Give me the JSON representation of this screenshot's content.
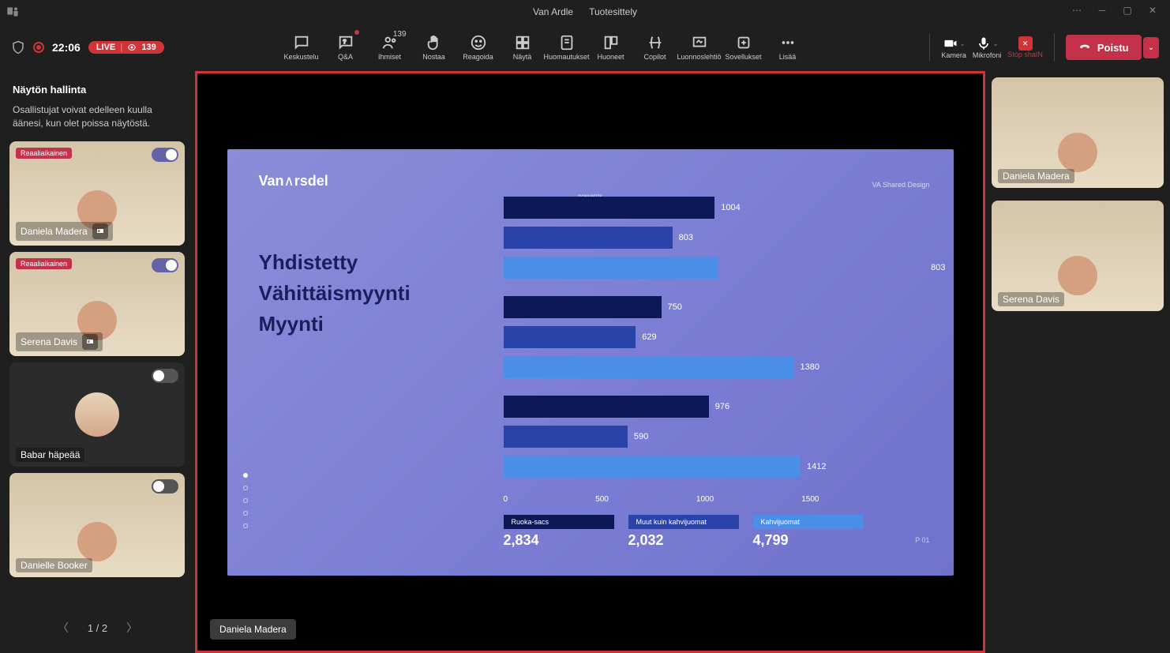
{
  "titlebar": {
    "org": "Van Ardle",
    "meeting": "Tuotesittely"
  },
  "toolbar": {
    "timer": "22:06",
    "live_label": "LIVE",
    "live_count": "139",
    "buttons": {
      "chat": "Keskustelu",
      "qa": "Q&A",
      "people": "Ihmiset",
      "people_count": "139",
      "raise": "Nostaa",
      "react": "Reagoida",
      "view": "Näytä",
      "notes": "Huomautukset",
      "rooms": "Huoneet",
      "copilot": "Copilot",
      "draft": "Luonnoslehtiö",
      "apps": "Sovellukset",
      "more": "Lisää"
    },
    "camera": "Kamera",
    "mic": "Mikrofoni",
    "stop_share": "Stop shaIN",
    "leave": "Poistu"
  },
  "sidebar": {
    "title": "Näytön hallinta",
    "desc": "Osallistujat voivat edelleen kuulla äänesi, kun olet poissa näytöstä.",
    "pager": "1 / 2",
    "participants": [
      {
        "name": "Daniela Madera",
        "live": true,
        "toggle_on": true,
        "pin": true
      },
      {
        "name": "Serena Davis",
        "live": true,
        "toggle_on": true,
        "pin": true
      },
      {
        "name": "Babar häpeää",
        "live": false,
        "toggle_on": false,
        "pin": false,
        "circle": true
      },
      {
        "name": "Danielle Booker",
        "live": false,
        "toggle_on": false,
        "pin": false
      }
    ],
    "live_badge": "Reaaliaikainen"
  },
  "stage": {
    "presenter": "Daniela  Madera"
  },
  "right_panel": {
    "participants": [
      {
        "name": "Daniela Madera"
      },
      {
        "name": "Serena Davis"
      }
    ]
  },
  "chart_data": {
    "type": "bar",
    "watermark": "VA Shared Design",
    "logo": "Van Arsdel",
    "logo_sub": "presents",
    "title_lines": [
      "Yhdistetty",
      "Vähittäismyynti",
      "Myynti"
    ],
    "page": "P 01",
    "xlim": [
      0,
      1500
    ],
    "x_ticks": [
      "0",
      "500",
      "1000",
      "1500"
    ],
    "groups": [
      {
        "values": [
          1004,
          803,
          803
        ],
        "extra_width_last": 1520
      },
      {
        "values": [
          750,
          629,
          1380
        ]
      },
      {
        "values": [
          976,
          590,
          1412
        ]
      }
    ],
    "series_colors": [
      "dark",
      "mid",
      "light"
    ],
    "legend": [
      {
        "label": "Ruoka-sacs",
        "value": "2,834",
        "color": "dark"
      },
      {
        "label": "Muut kuin kahvijuomat",
        "value": "2,032",
        "color": "mid"
      },
      {
        "label": "Kahvijuomat",
        "value": "4,799",
        "color": "light"
      }
    ]
  }
}
